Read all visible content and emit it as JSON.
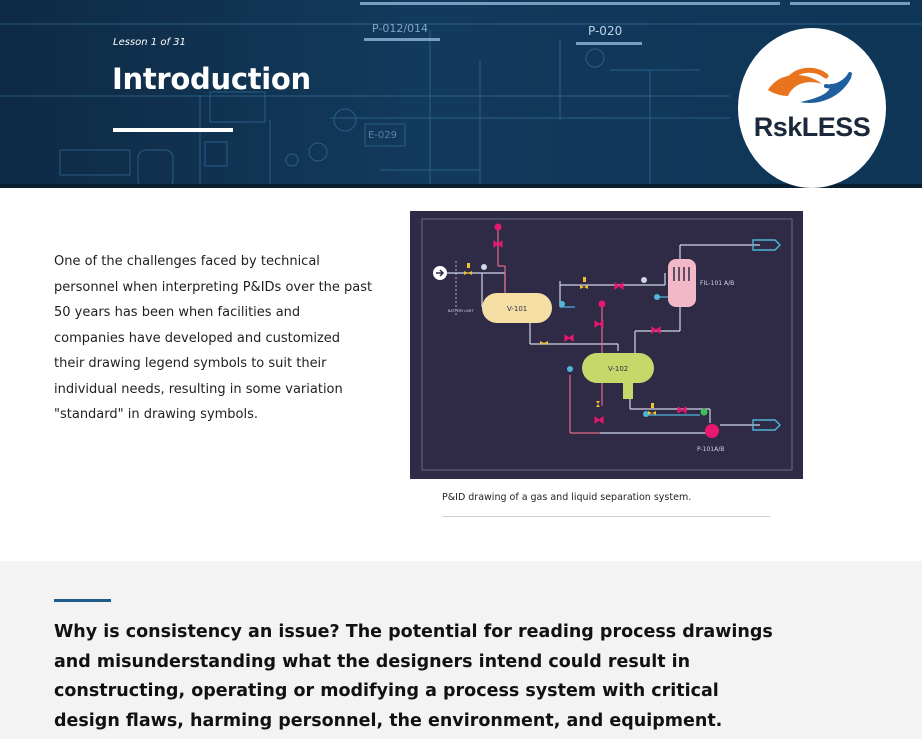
{
  "header": {
    "lesson_label": "Lesson 1 of 31",
    "title": "Introduction",
    "logo_text": "RskLESS",
    "logo_text_part1": "Rsk",
    "logo_text_part2": "LESS",
    "blueprint_labels": [
      "P-012/014",
      "P-020",
      "E-029"
    ],
    "colors": {
      "banner": "#123a5c",
      "logo_orange": "#e8741e",
      "logo_blue": "#1f5f9e"
    }
  },
  "intro": {
    "paragraph_lines": [
      "One of the challenges faced by technical",
      "personnel when interpreting P&IDs over the past",
      "50 years has been when facilities and",
      "companies have developed and customized",
      "their drawing legend symbols to suit their",
      "individual needs, resulting in some variation",
      "\"standard\" in drawing symbols."
    ]
  },
  "figure": {
    "caption": "P&ID drawing of a gas and liquid separation system.",
    "labels": {
      "v101": "V-101",
      "v102": "V-102",
      "filter": "FIL-101 A/B",
      "pump": "P-101A/B",
      "battery_limit": "BATTERY LIMIT"
    },
    "colors": {
      "background": "#2f2a45",
      "vessel1": "#f6dfa4",
      "vessel2": "#c7d86a",
      "filter": "#f2b8c8",
      "pump": "#e8176f",
      "process_line": "#cfd6e6",
      "gas_line": "#e06a8a",
      "liquid_line": "#4fb6d9"
    }
  },
  "callout": {
    "text": "Why is consistency an issue? The potential for reading process drawings and misunderstanding what the designers intend could result in constructing, operating or modifying a process system with critical design flaws, harming personnel, the environment, and equipment."
  }
}
